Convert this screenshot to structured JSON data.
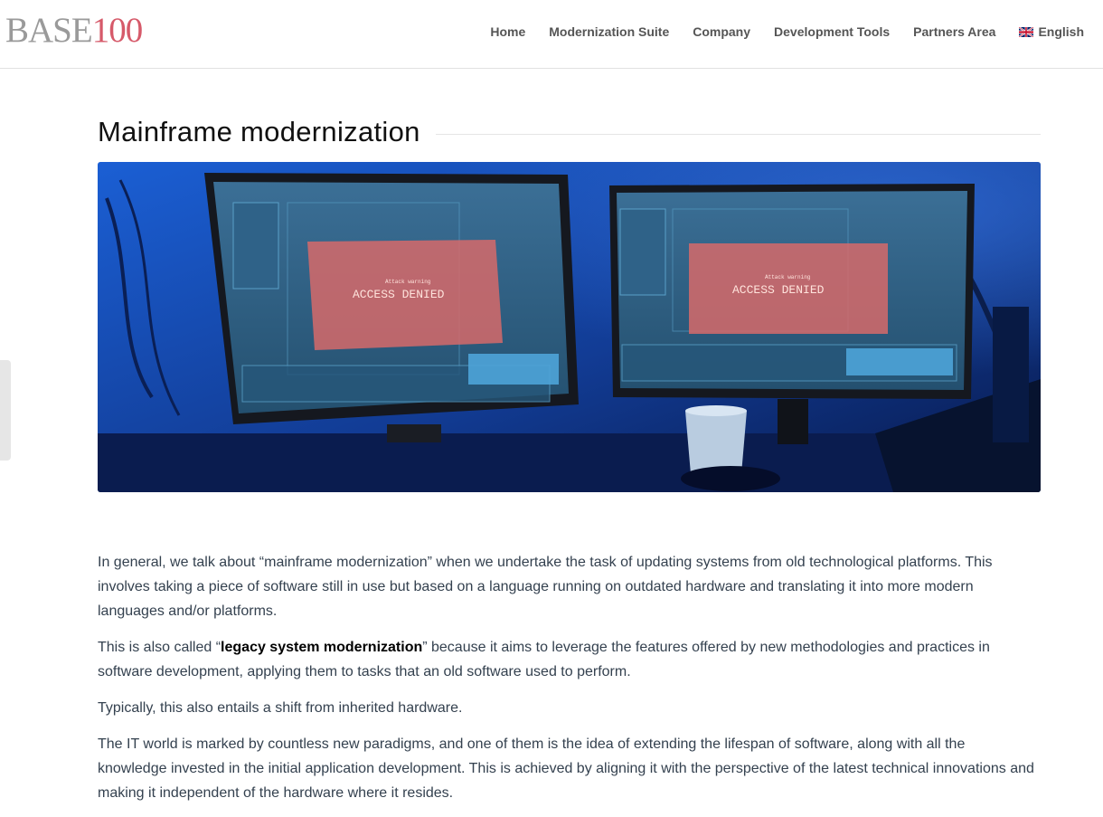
{
  "header": {
    "logo": {
      "part_a": "BASE",
      "part_b": "100"
    },
    "nav": [
      {
        "label": "Home"
      },
      {
        "label": "Modernization Suite"
      },
      {
        "label": "Company"
      },
      {
        "label": "Development Tools"
      },
      {
        "label": "Partners Area"
      }
    ],
    "language": {
      "label": "English",
      "icon": "uk-flag-icon"
    }
  },
  "main": {
    "title": "Mainframe modernization",
    "hero_image": {
      "icon": "hero-image",
      "screen_text_left": "ACCESS DENIED",
      "screen_text_right": "ACCESS DENIED",
      "screen_subtext": "Attack warning"
    },
    "paragraphs": [
      {
        "text": "In general, we talk about “mainframe modernization” when we undertake the task of updating systems from old technological platforms. This involves taking a piece of software still in use but based on a language running on outdated hardware and translating it into more modern languages and/or platforms."
      },
      {
        "pre": "This is also called “",
        "bold": "legacy system modernization",
        "post": "” because it aims to leverage the features offered by new methodologies and practices in software development, applying them to tasks that an old software used to perform."
      },
      {
        "text": "Typically, this also entails a shift from inherited hardware."
      },
      {
        "text": "The IT world is marked by countless new paradigms, and one of them is the idea of extending the lifespan of software, along with all the knowledge invested in the initial application development. This is achieved by aligning it with the perspective of the latest technical innovations and making it independent of the hardware where it resides."
      }
    ]
  },
  "colors": {
    "logo_gray": "#9a9a9a",
    "logo_red": "#d65a6a",
    "nav_text": "#555555",
    "body_text": "#34414f",
    "hero_blue": "#1e4fb0"
  }
}
